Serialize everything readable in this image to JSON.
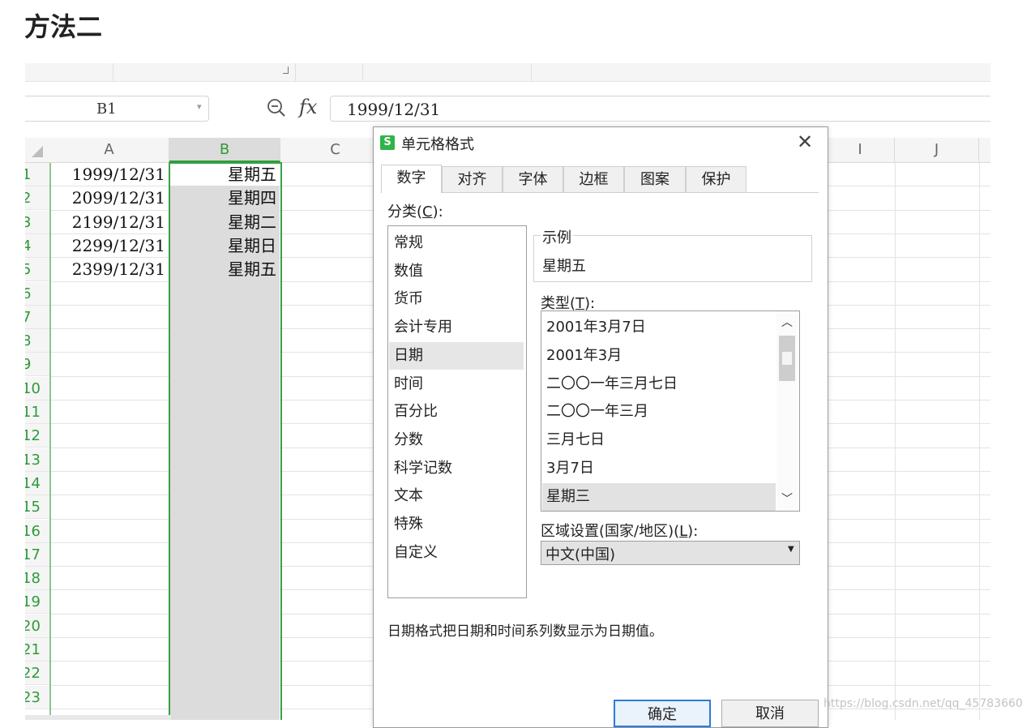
{
  "heading": "方法二",
  "formula_bar": {
    "name_box": "B1",
    "fx_label": "fx",
    "formula": "1999/12/31"
  },
  "sheet": {
    "columns": [
      "A",
      "B",
      "C",
      "I",
      "J"
    ],
    "rows": [
      "1",
      "2",
      "3",
      "4",
      "5",
      "6",
      "7",
      "8",
      "9",
      "10",
      "11",
      "12",
      "13",
      "14",
      "15",
      "16",
      "17",
      "18",
      "19",
      "20",
      "21",
      "22",
      "23"
    ],
    "col_a": [
      "1999/12/31",
      "2099/12/31",
      "2199/12/31",
      "2299/12/31",
      "2399/12/31"
    ],
    "col_b": [
      "星期五",
      "星期四",
      "星期二",
      "星期日",
      "星期五"
    ]
  },
  "dialog": {
    "title": "单元格格式",
    "tabs": [
      "数字",
      "对齐",
      "字体",
      "边框",
      "图案",
      "保护"
    ],
    "category_label": "分类(",
    "category_key": "C",
    "category_suffix": "):",
    "categories": [
      "常规",
      "数值",
      "货币",
      "会计专用",
      "日期",
      "时间",
      "百分比",
      "分数",
      "科学记数",
      "文本",
      "特殊",
      "自定义"
    ],
    "selected_category": "日期",
    "sample_legend": "示例",
    "sample_value": "星期五",
    "type_label": "类型(",
    "type_key": "T",
    "type_suffix": "):",
    "types": [
      "2001年3月7日",
      "2001年3月",
      "二〇〇一年三月七日",
      "二〇〇一年三月",
      "三月七日",
      "3月7日",
      "星期三"
    ],
    "selected_type": "星期三",
    "locale_label": "区域设置(国家/地区)(",
    "locale_key": "L",
    "locale_suffix": "):",
    "locale_value": "中文(中国)",
    "description": "日期格式把日期和时间系列数显示为日期值。",
    "ok_label": "确定",
    "cancel_label": "取消"
  },
  "watermark": {
    "url": "https://blog.csdn.net/qq_45783660"
  },
  "colors": {
    "accent_green": "#2e9b3a",
    "selection_gray": "#dcdcdc",
    "primary_button_border": "#2d7bd6"
  }
}
